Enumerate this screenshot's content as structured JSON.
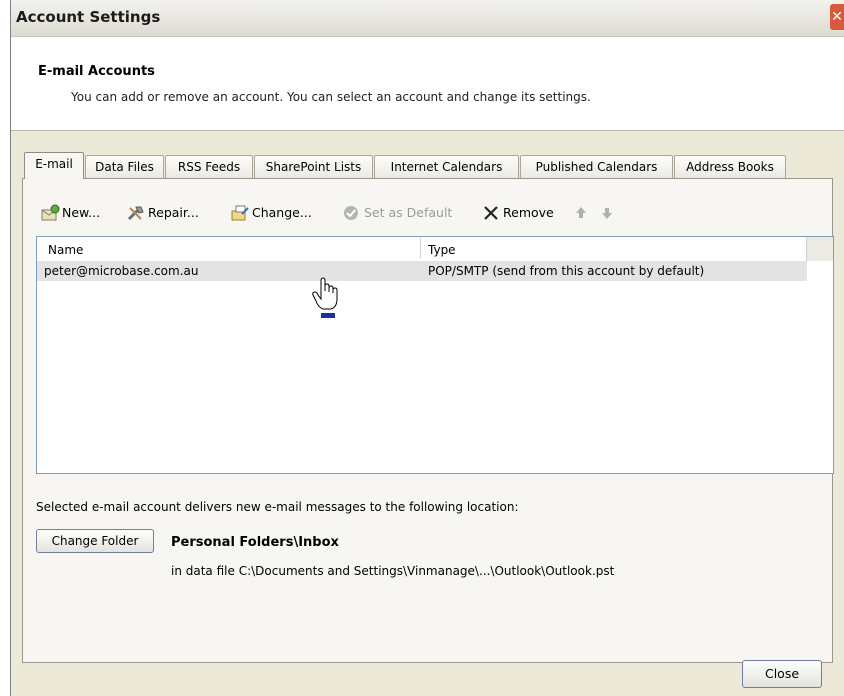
{
  "window": {
    "title": "Account Settings"
  },
  "header": {
    "title": "E-mail Accounts",
    "description": "You can add or remove an account. You can select an account and change its settings."
  },
  "tabs": [
    {
      "label": "E-mail",
      "active": true
    },
    {
      "label": "Data Files",
      "active": false
    },
    {
      "label": "RSS Feeds",
      "active": false
    },
    {
      "label": "SharePoint Lists",
      "active": false
    },
    {
      "label": "Internet Calendars",
      "active": false
    },
    {
      "label": "Published Calendars",
      "active": false
    },
    {
      "label": "Address Books",
      "active": false
    }
  ],
  "toolbar": {
    "new_label": "New...",
    "repair_label": "Repair...",
    "change_label": "Change...",
    "set_default_label": "Set as Default",
    "remove_label": "Remove",
    "icons": [
      "new-account-icon",
      "repair-icon",
      "change-icon",
      "set-default-icon",
      "remove-icon",
      "move-up-icon",
      "move-down-icon"
    ]
  },
  "accounts_list": {
    "columns": [
      "Name",
      "Type"
    ],
    "rows": [
      {
        "name": "peter@microbase.com.au",
        "type": "POP/SMTP (send from this account by default)"
      }
    ]
  },
  "delivery": {
    "label": "Selected e-mail account delivers new e-mail messages to the following location:",
    "change_folder_label": "Change Folder",
    "folder_name": "Personal Folders\\Inbox",
    "data_file": "in data file C:\\Documents and Settings\\Vinmanage\\...\\Outlook\\Outlook.pst"
  },
  "footer": {
    "close_label": "Close"
  },
  "colors": {
    "dialog_bg": "#ece9d8",
    "close_red": "#d75a3c",
    "list_border": "#7f9db9"
  }
}
